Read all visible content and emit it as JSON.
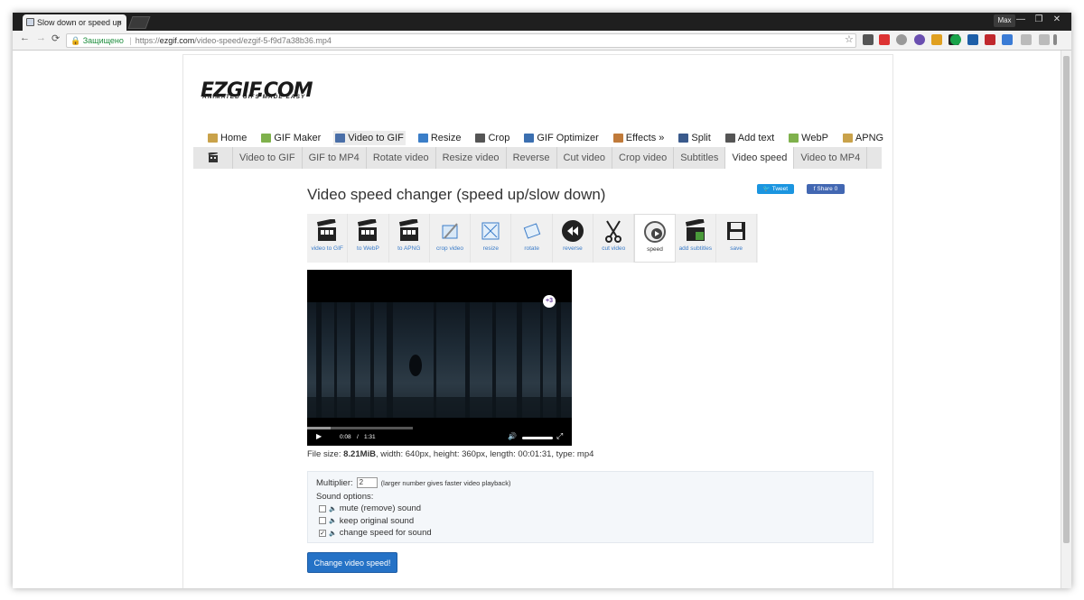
{
  "browser": {
    "tab_title": "Slow down or speed up",
    "tab_close": "×",
    "user": "Max",
    "window_controls": [
      "—",
      "❐",
      "✕"
    ],
    "nav": {
      "back": "←",
      "forward": "→",
      "reload": "⟳"
    },
    "address": {
      "secure_label": "Защищено",
      "separator": "|",
      "scheme": "https://",
      "host": "ezgif.com",
      "path": "/video-speed/ezgif-5-f9d7a38b36.mp4"
    },
    "star": "☆"
  },
  "site": {
    "logo": "EZGIF.COM",
    "tagline": "ANIMATED GIFS MADE EASY",
    "main_nav": [
      {
        "label": "Home",
        "icon": "home-icon",
        "color": "#c9a24a"
      },
      {
        "label": "GIF Maker",
        "icon": "gif-maker-icon",
        "color": "#7fb14c"
      },
      {
        "label": "Video to GIF",
        "icon": "video-icon",
        "color": "#4a6fa8",
        "active": true
      },
      {
        "label": "Resize",
        "icon": "resize-icon",
        "color": "#3b7ec8"
      },
      {
        "label": "Crop",
        "icon": "crop-icon",
        "color": "#555555"
      },
      {
        "label": "GIF Optimizer",
        "icon": "optimizer-icon",
        "color": "#3b6fb0"
      },
      {
        "label": "Effects »",
        "icon": "effects-icon",
        "color": "#c07a3a"
      },
      {
        "label": "Split",
        "icon": "split-icon",
        "color": "#3a5a8c"
      },
      {
        "label": "Add text",
        "icon": "text-icon",
        "color": "#555555"
      },
      {
        "label": "WebP",
        "icon": "webp-icon",
        "color": "#7fb14c"
      },
      {
        "label": "APNG",
        "icon": "apng-icon",
        "color": "#c9a24a"
      }
    ],
    "sub_nav": [
      "Video to GIF",
      "GIF to MP4",
      "Rotate video",
      "Resize video",
      "Reverse",
      "Cut video",
      "Crop video",
      "Subtitles",
      "Video speed",
      "Video to MP4"
    ],
    "sub_nav_active": "Video speed"
  },
  "main": {
    "title": "Video speed changer (speed up/slow down)",
    "tweet": "Tweet",
    "share": "Share 0",
    "tools": [
      {
        "label": "video to GIF",
        "icon": "clapper-icon"
      },
      {
        "label": "to WebP",
        "icon": "clapper-icon"
      },
      {
        "label": "to APNG",
        "icon": "clapper-icon"
      },
      {
        "label": "crop video",
        "icon": "crop-video-icon"
      },
      {
        "label": "resize",
        "icon": "resize-video-icon"
      },
      {
        "label": "rotate",
        "icon": "rotate-icon"
      },
      {
        "label": "reverse",
        "icon": "reverse-icon"
      },
      {
        "label": "cut video",
        "icon": "scissors-icon"
      },
      {
        "label": "speed",
        "icon": "speed-icon",
        "active": true
      },
      {
        "label": "add subtitles",
        "icon": "subtitles-icon"
      },
      {
        "label": "save",
        "icon": "save-icon"
      }
    ],
    "player": {
      "current_time": "0:08",
      "separator": "/",
      "duration": "1:31",
      "progress": 0.088,
      "badge": "+3"
    },
    "file_info": {
      "prefix": "File size: ",
      "size": "8.21MiB",
      "rest": ", width: 640px, height: 360px, length: 00:01:31, type: mp4"
    },
    "options": {
      "multiplier_label": "Multiplier:",
      "multiplier_value": "2",
      "multiplier_hint": "(larger number gives faster video playback)",
      "sound_label": "Sound options:",
      "sound_options": [
        {
          "label": "mute (remove) sound",
          "checked": false
        },
        {
          "label": "keep original sound",
          "checked": false
        },
        {
          "label": "change speed for sound",
          "checked": true
        }
      ]
    },
    "submit": "Change video speed!"
  }
}
